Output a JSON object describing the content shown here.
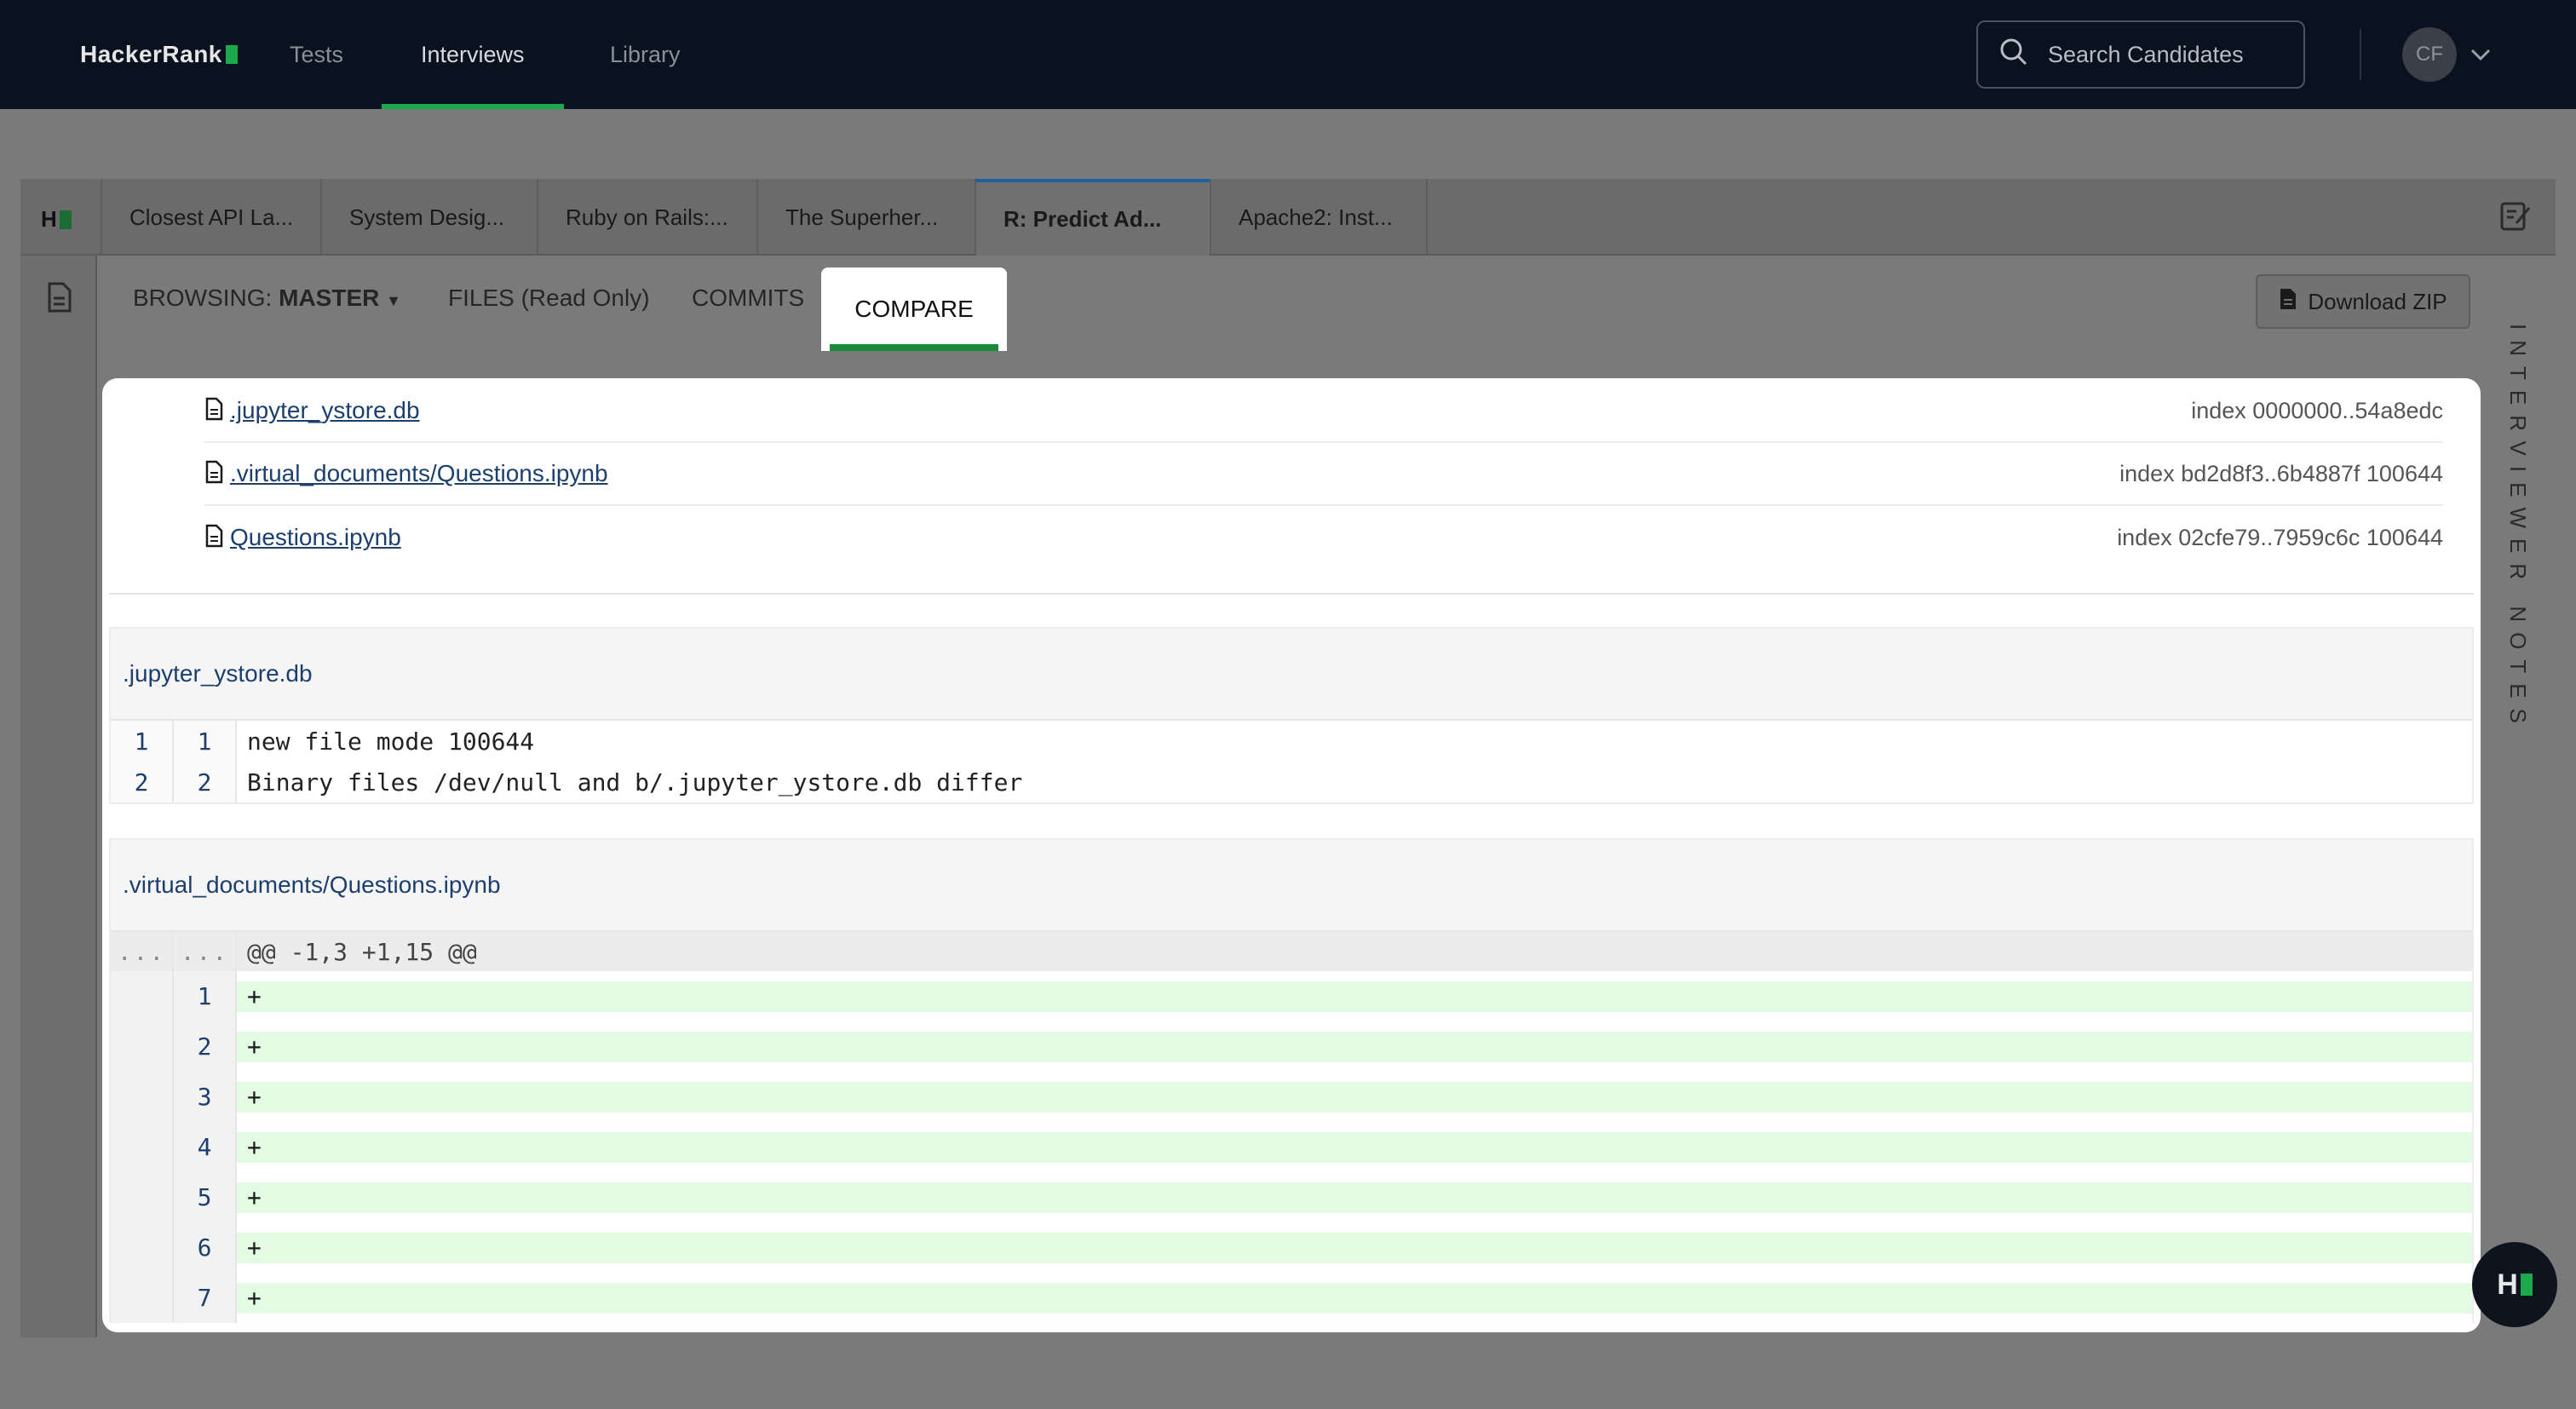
{
  "app": {
    "logo_text": "HackerRank"
  },
  "topnav": {
    "items": [
      {
        "label": "Tests"
      },
      {
        "label": "Interviews"
      },
      {
        "label": "Library"
      }
    ],
    "search_placeholder": "Search Candidates",
    "avatar_initials": "CF"
  },
  "tabs": [
    {
      "label": "Closest API La..."
    },
    {
      "label": "System Desig..."
    },
    {
      "label": "Ruby on Rails:..."
    },
    {
      "label": "The Superher..."
    },
    {
      "label": "R: Predict Ad..."
    },
    {
      "label": "Apache2: Inst..."
    }
  ],
  "subnav": {
    "browsing_prefix": "BROWSING:",
    "branch": "MASTER",
    "files": "FILES (Read Only)",
    "commits": "COMMITS",
    "compare": "COMPARE",
    "download": "Download ZIP",
    "interviewer_notes": "INTERVIEWER NOTES"
  },
  "changed_files": [
    {
      "name": ".jupyter_ystore.db",
      "index": "index 0000000..54a8edc"
    },
    {
      "name": ".virtual_documents/Questions.ipynb",
      "index": "index bd2d8f3..6b4887f 100644"
    },
    {
      "name": "Questions.ipynb",
      "index": "index 02cfe79..7959c6c 100644"
    }
  ],
  "diffs": [
    {
      "file": ".jupyter_ystore.db",
      "lines": [
        {
          "old": "1",
          "new": "1",
          "text": "new file mode 100644"
        },
        {
          "old": "2",
          "new": "2",
          "text": "Binary files /dev/null and b/.jupyter_ystore.db differ"
        }
      ]
    },
    {
      "file": ".virtual_documents/Questions.ipynb",
      "hunk": {
        "old": "...",
        "new": "...",
        "text": "@@ -1,3 +1,15 @@"
      },
      "added": [
        {
          "new": "1",
          "text": "+"
        },
        {
          "new": "2",
          "text": "+"
        },
        {
          "new": "3",
          "text": "+"
        },
        {
          "new": "4",
          "text": "+"
        },
        {
          "new": "5",
          "text": "+"
        },
        {
          "new": "6",
          "text": "+"
        },
        {
          "new": "7",
          "text": "+"
        }
      ]
    }
  ],
  "fab": {
    "label": "H"
  },
  "colors": {
    "brand_green": "#1ba94c",
    "navbar": "#0a1220",
    "link": "#1c3f6e",
    "added_bg": "#e3fbe3"
  }
}
